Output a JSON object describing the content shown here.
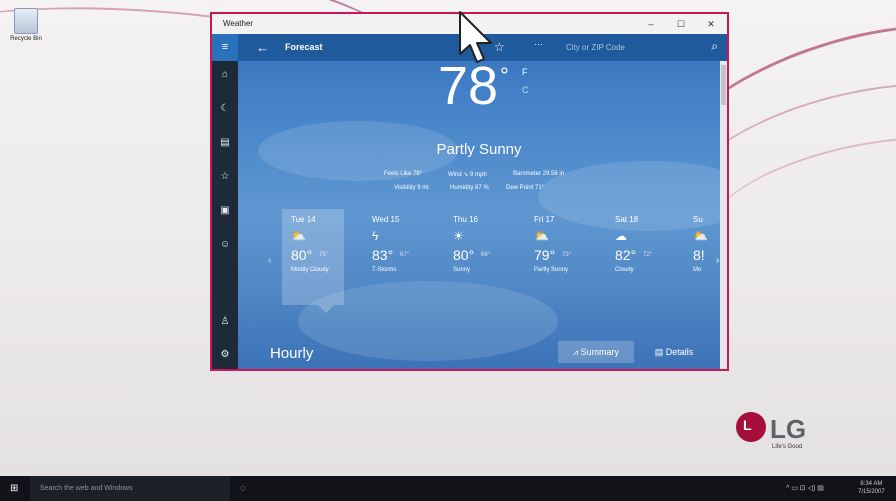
{
  "desktop": {
    "recycle_bin_label": "Recycle Bin",
    "brand": {
      "logo_letter": "L",
      "name": "LG",
      "tagline": "Life's Good"
    }
  },
  "window": {
    "title": "Weather",
    "controls": {
      "minimize": "–",
      "maximize": "☐",
      "close": "✕"
    },
    "accent_border": "#c8185a"
  },
  "appbar": {
    "menu_icon": "hamburger-icon",
    "back_icon": "back-arrow-icon",
    "title": "Forecast",
    "more": "···",
    "search_placeholder": "City or ZIP Code"
  },
  "rail": [
    {
      "name": "home-icon",
      "glyph": "⌂"
    },
    {
      "name": "moon-icon",
      "glyph": "☾"
    },
    {
      "name": "maps-icon",
      "glyph": "▤"
    },
    {
      "name": "favorites-icon",
      "glyph": "☆"
    },
    {
      "name": "news-icon",
      "glyph": "▣"
    },
    {
      "name": "smiley-icon",
      "glyph": "☺"
    },
    {
      "name": "account-icon",
      "glyph": "♙"
    },
    {
      "name": "settings-icon",
      "glyph": "⚙"
    }
  ],
  "current": {
    "temperature": "78",
    "degree": "°",
    "unit_f": "F",
    "unit_c": "C",
    "condition": "Partly Sunny",
    "details_row1": [
      "Feels Like  78°",
      "Wind  ➘ 9 mph",
      "Barometer  29.56 in"
    ],
    "details_row2": [
      "Visibility  9 mi",
      "Humidity  87 %",
      "Dew Point  71°"
    ]
  },
  "forecast": [
    {
      "day": "Tue 14",
      "icon": "⛅",
      "high": "80°",
      "low": "75°",
      "condition": "Mostly Cloudy",
      "selected": true
    },
    {
      "day": "Wed 15",
      "icon": "ϟ",
      "high": "83°",
      "low": "67°",
      "condition": "T-Storms"
    },
    {
      "day": "Thu 16",
      "icon": "☀",
      "high": "80°",
      "low": "68°",
      "condition": "Sunny"
    },
    {
      "day": "Fri 17",
      "icon": "⛅",
      "high": "79°",
      "low": "73°",
      "condition": "Partly Sunny"
    },
    {
      "day": "Sat 18",
      "icon": "☁",
      "high": "82°",
      "low": "72°",
      "condition": "Cloudy"
    },
    {
      "day": "Su",
      "icon": "⛅",
      "high": "8!",
      "low": "",
      "condition": "Mo"
    }
  ],
  "hourly": {
    "title": "Hourly",
    "summary_label": "Summary",
    "details_label": "Details"
  },
  "taskbar": {
    "search_placeholder": "Search the web and Windows",
    "tray_icons": "^  ▭  ⊡  ◁)  ▤",
    "time": "8:34 AM",
    "date": "7/15/2007"
  }
}
